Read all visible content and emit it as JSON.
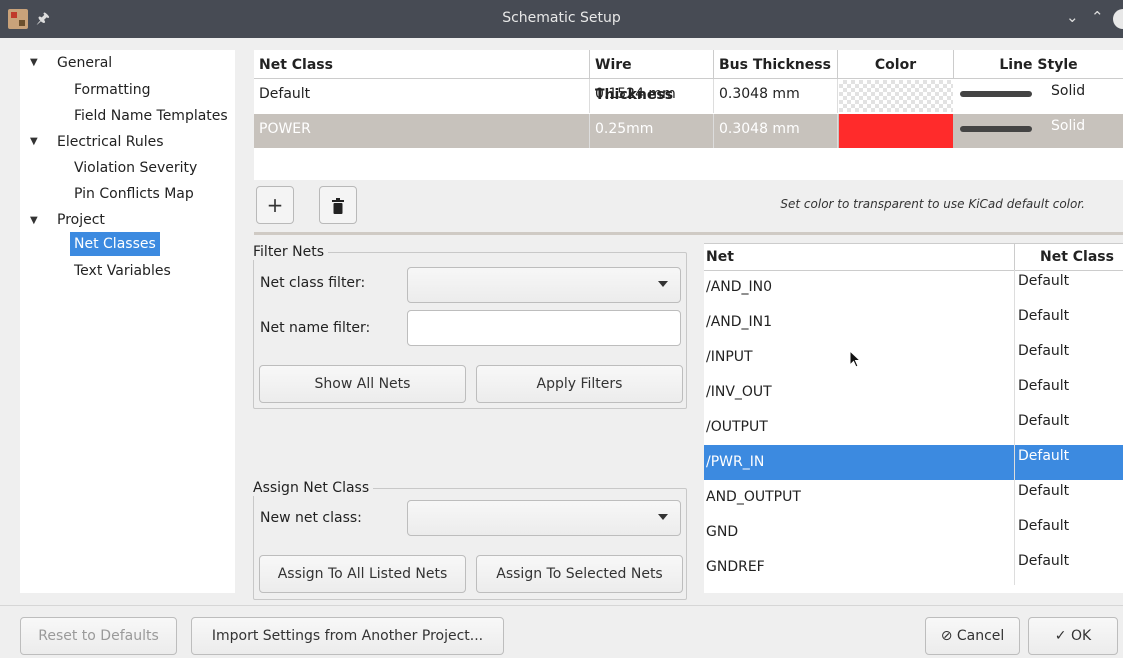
{
  "window": {
    "title": "Schematic Setup"
  },
  "sidebar": {
    "items": [
      {
        "label": "General",
        "level": 0,
        "expanded": true
      },
      {
        "label": "Formatting",
        "level": 1
      },
      {
        "label": "Field Name Templates",
        "level": 1
      },
      {
        "label": "Electrical Rules",
        "level": 0,
        "expanded": true
      },
      {
        "label": "Violation Severity",
        "level": 1
      },
      {
        "label": "Pin Conflicts Map",
        "level": 1
      },
      {
        "label": "Project",
        "level": 0,
        "expanded": true
      },
      {
        "label": "Net Classes",
        "level": 1,
        "selected": true
      },
      {
        "label": "Text Variables",
        "level": 1
      }
    ]
  },
  "netclass_table": {
    "columns": [
      "Net Class",
      "Wire Thickness",
      "Bus Thickness",
      "Color",
      "Line Style"
    ],
    "rows": [
      {
        "name": "Default",
        "wire": "0.1524 mm",
        "bus": "0.3048 mm",
        "color": "transparent",
        "style": "Solid"
      },
      {
        "name": "POWER",
        "wire": "0.25mm",
        "bus": "0.3048 mm",
        "color": "#ff2b2b",
        "style": "Solid",
        "selected": true
      }
    ]
  },
  "toolbar": {
    "add_icon": "plus-icon",
    "delete_icon": "trash-icon",
    "hint": "Set color to transparent to use KiCad default color."
  },
  "filter_nets": {
    "title": "Filter Nets",
    "class_filter_label": "Net class filter:",
    "class_filter_value": "",
    "name_filter_label": "Net name filter:",
    "name_filter_value": "",
    "show_all": "Show All Nets",
    "apply": "Apply Filters"
  },
  "assign": {
    "title": "Assign Net Class",
    "new_class_label": "New net class:",
    "new_class_value": "",
    "assign_all": "Assign To All Listed Nets",
    "assign_selected": "Assign To Selected Nets"
  },
  "nets_table": {
    "columns": [
      "Net",
      "Net Class"
    ],
    "rows": [
      {
        "net": "/AND_IN0",
        "class": "Default"
      },
      {
        "net": "/AND_IN1",
        "class": "Default"
      },
      {
        "net": "/INPUT",
        "class": "Default"
      },
      {
        "net": "/INV_OUT",
        "class": "Default"
      },
      {
        "net": "/OUTPUT",
        "class": "Default"
      },
      {
        "net": "/PWR_IN",
        "class": "Default",
        "selected": true
      },
      {
        "net": "AND_OUTPUT",
        "class": "Default"
      },
      {
        "net": "GND",
        "class": "Default"
      },
      {
        "net": "GNDREF",
        "class": "Default"
      }
    ]
  },
  "footer": {
    "reset": "Reset to Defaults",
    "import": "Import Settings from Another Project...",
    "cancel": "Cancel",
    "ok": "OK"
  }
}
